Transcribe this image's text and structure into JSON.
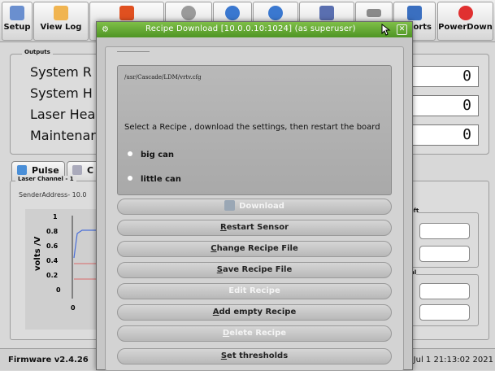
{
  "toolbar": {
    "buttons": [
      {
        "label": "Setup",
        "icon": "gears-icon"
      },
      {
        "label": "View Log",
        "icon": "clipboard-icon"
      },
      {
        "label": "",
        "icon": "red-square-icon"
      },
      {
        "label": "",
        "icon": "settings-icon"
      },
      {
        "label": "",
        "icon": "blue-arrow-icon"
      },
      {
        "label": "",
        "icon": "blue-arrow-icon"
      },
      {
        "label": "",
        "icon": "checklist-icon"
      },
      {
        "label": "",
        "icon": "lines-icon"
      },
      {
        "label": "ports",
        "icon": "floppy-icon"
      },
      {
        "label": "PowerDown",
        "icon": "power-icon"
      }
    ]
  },
  "outputs": {
    "title": "Outputs",
    "rows": [
      {
        "label": "System R",
        "value": "0"
      },
      {
        "label": "System H",
        "value": "0"
      },
      {
        "label": "Laser Hea",
        "value": "0"
      },
      {
        "label": "Maintenar",
        "value": "0"
      }
    ]
  },
  "tabs": [
    {
      "label": "Pulse"
    },
    {
      "label": "C"
    }
  ],
  "laser": {
    "group_title": "Laser Channel - 1",
    "sender": "SenderAddress- 10.0",
    "ylabel": "volts /V",
    "yticks": [
      "1",
      "0.8",
      "0.6",
      "0.4",
      "0.2",
      "0"
    ],
    "xtick": "0",
    "right_group1": "ol left",
    "right_group2": "ontal",
    "right_label_n": "n"
  },
  "status": {
    "firmware": "Firmware v2.4.26",
    "clock": "u Jul 1 21:13:02 2021"
  },
  "dialog": {
    "title": "Recipe Download [10.0.0.10:1024] (as superuser)",
    "config_path": "/usr/Cascade/LDM/vrtv.cfg",
    "instruction": "Select a Recipe , download the settings, then restart the board",
    "recipes": [
      "big can",
      "little can"
    ],
    "buttons": {
      "download": "Download",
      "restart_u": "R",
      "restart_rest": "estart Sensor",
      "change_u": "C",
      "change_rest": "hange Recipe File",
      "save_u": "S",
      "save_rest": "ave Recipe File",
      "edit": "Edit Recipe",
      "add_u": "A",
      "add_rest": "dd empty Recipe",
      "delete_u": "D",
      "delete_rest": "elete Recipe",
      "thresholds_u": "S",
      "thresholds_rest": "et thresholds"
    },
    "colors": {
      "title_bar": "#5fa82e",
      "panel": "#b2b2b2"
    }
  }
}
